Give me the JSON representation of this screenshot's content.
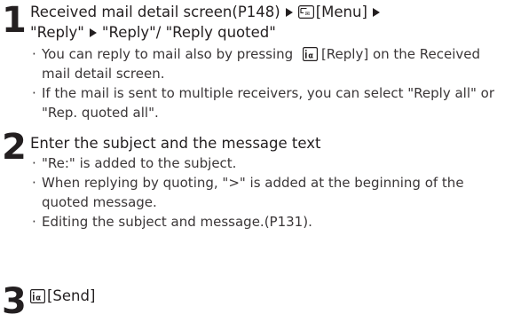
{
  "steps": [
    {
      "number": "1",
      "title_part1": "Received mail detail screen(P148)",
      "title_part2": "[Menu]",
      "title_part3": "\"Reply\"",
      "title_part4": "\"Reply\"/ \"Reply quoted\"",
      "notes": [
        {
          "pre": "You can reply to mail also by pressing",
          "post": "[Reply] on the Received mail detail screen."
        },
        {
          "text": "If the mail is sent to multiple receivers, you can select \"Reply all\" or \"Rep. quoted all\"."
        }
      ]
    },
    {
      "number": "2",
      "title": "Enter the subject and the message text",
      "notes": [
        "\"Re:\" is added to the subject.",
        "When replying by quoting, \">\" is added at the beginning of the quoted message.",
        "Editing the subject and message.(P131)."
      ]
    },
    {
      "number": "3",
      "title": "[Send]"
    }
  ],
  "bullet": "·",
  "icons": {
    "menu_key": "menu-key-icon",
    "i_alpha_key": "i-alpha-key-icon"
  },
  "colors": {
    "text": "#231f20",
    "note_text": "#3a3637"
  }
}
